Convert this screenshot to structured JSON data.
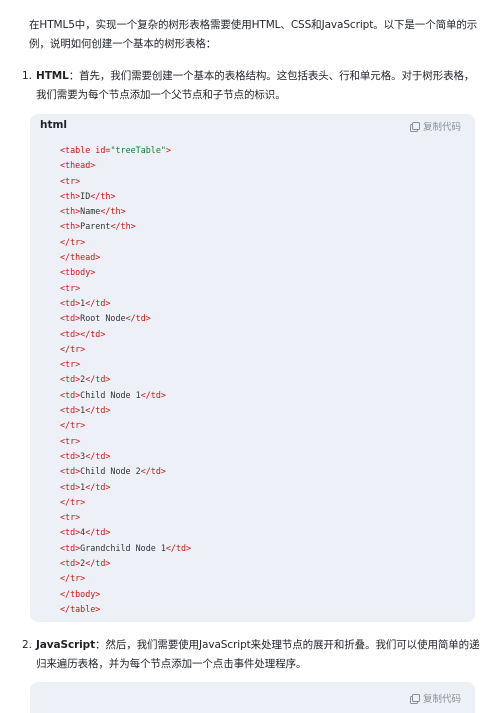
{
  "intro": "在HTML5中，实现一个复杂的树形表格需要使用HTML、CSS和JavaScript。以下是一个简单的示例，说明如何创建一个基本的树形表格：",
  "steps": [
    {
      "num": "1.",
      "title": "HTML",
      "text": "：首先，我们需要创建一个基本的表格结构。这包括表头、行和单元格。对于树形表格，我们需要为每个节点添加一个父节点和子节点的标识。"
    },
    {
      "num": "2.",
      "title": "JavaScript",
      "text": "：然后，我们需要使用JavaScript来处理节点的展开和折叠。我们可以使用简单的递归来遍历表格，并为每个节点添加一个点击事件处理程序。"
    }
  ],
  "code_block_1": {
    "lang": "html",
    "copy_label": "复制代码",
    "lines": [
      {
        "open": "<table",
        "attr": " id=",
        "str": "\"treeTable\"",
        "close": ">",
        "text": "",
        "end": ""
      },
      {
        "open": "<thead>",
        "text": "",
        "end": ""
      },
      {
        "open": "<tr>",
        "text": "",
        "end": ""
      },
      {
        "open": "<th>",
        "text": "ID",
        "end": "</th>"
      },
      {
        "open": "<th>",
        "text": "Name",
        "end": "</th>"
      },
      {
        "open": "<th>",
        "text": "Parent",
        "end": "</th>"
      },
      {
        "open": "</tr>",
        "text": "",
        "end": ""
      },
      {
        "open": "</thead>",
        "text": "",
        "end": ""
      },
      {
        "open": "<tbody>",
        "text": "",
        "end": ""
      },
      {
        "open": "<tr>",
        "text": "",
        "end": ""
      },
      {
        "open": "<td>",
        "text": "1",
        "end": "</td>"
      },
      {
        "open": "<td>",
        "text": "Root Node",
        "end": "</td>"
      },
      {
        "open": "<td>",
        "text": "",
        "end": "</td>"
      },
      {
        "open": "</tr>",
        "text": "",
        "end": ""
      },
      {
        "open": "<tr>",
        "text": "",
        "end": ""
      },
      {
        "open": "<td>",
        "text": "2",
        "end": "</td>"
      },
      {
        "open": "<td>",
        "text": "Child Node 1",
        "end": "</td>"
      },
      {
        "open": "<td>",
        "text": "1",
        "end": "</td>"
      },
      {
        "open": "</tr>",
        "text": "",
        "end": ""
      },
      {
        "open": "<tr>",
        "text": "",
        "end": ""
      },
      {
        "open": "<td>",
        "text": "3",
        "end": "</td>"
      },
      {
        "open": "<td>",
        "text": "Child Node 2",
        "end": "</td>"
      },
      {
        "open": "<td>",
        "text": "1",
        "end": "</td>"
      },
      {
        "open": "</tr>",
        "text": "",
        "end": ""
      },
      {
        "open": "<tr>",
        "text": "",
        "end": ""
      },
      {
        "open": "<td>",
        "text": "4",
        "end": "</td>"
      },
      {
        "open": "<td>",
        "text": "Grandchild Node 1",
        "end": "</td>"
      },
      {
        "open": "<td>",
        "text": "2",
        "end": "</td>"
      },
      {
        "open": "</tr>",
        "text": "",
        "end": ""
      },
      {
        "open": "</tbody>",
        "text": "",
        "end": ""
      },
      {
        "open": "</table>",
        "text": "",
        "end": ""
      }
    ]
  },
  "code_block_2": {
    "copy_label": "复制代码"
  }
}
